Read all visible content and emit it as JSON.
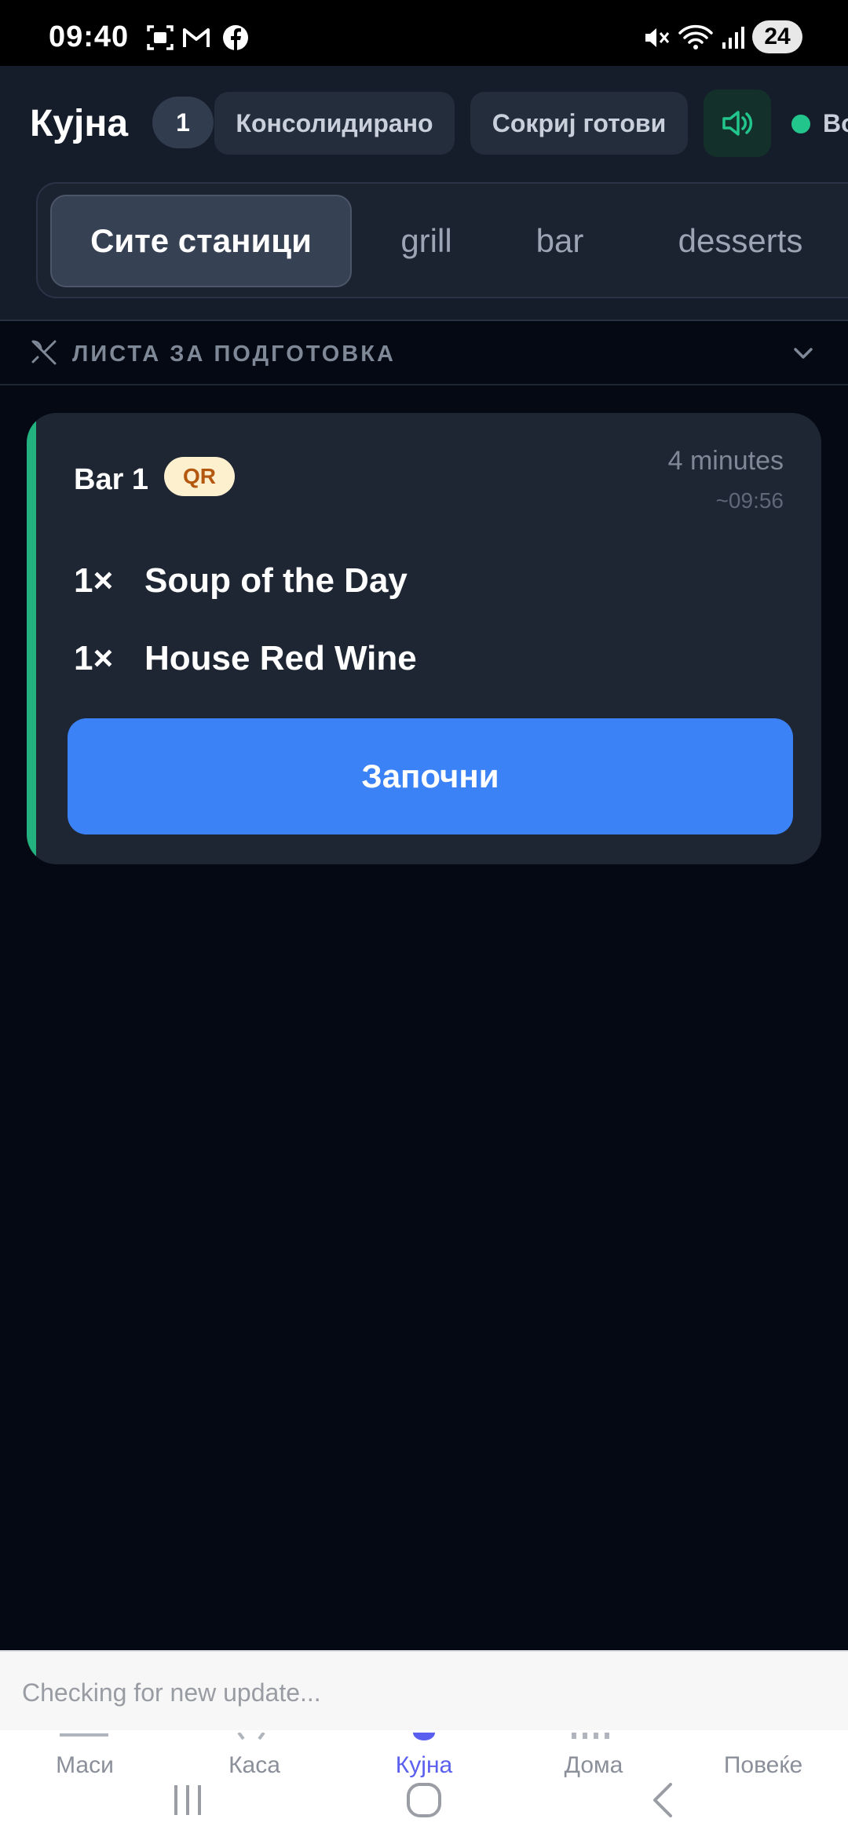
{
  "status_bar": {
    "time": "09:40",
    "battery": "24",
    "icons": [
      "screenshot-icon",
      "gmail-icon",
      "facebook-icon",
      "mute-icon",
      "wifi-icon",
      "signal-icon"
    ]
  },
  "header": {
    "title": "Кујна",
    "order_count": "1",
    "consolidated_label": "Консолидирано",
    "hide_done_label": "Сокриј готови",
    "sound_icon": "speaker-icon",
    "connection_label": "Во",
    "connection_color": "#22c58b"
  },
  "stations": {
    "tabs": [
      {
        "label": "Сите станици",
        "active": true
      },
      {
        "label": "grill",
        "active": false
      },
      {
        "label": "bar",
        "active": false
      },
      {
        "label": "desserts",
        "active": false
      }
    ]
  },
  "prep_list": {
    "label": "ЛИСТА ЗА ПОДГОТОВКА",
    "icon": "utensils-icon",
    "expanded": false
  },
  "orders": [
    {
      "table": "Bar 1",
      "source_badge": "QR",
      "elapsed": "4 minutes",
      "eta": "~09:56",
      "accent_color": "#22b17f",
      "items": [
        {
          "qty": "1×",
          "name": "Soup of the Day"
        },
        {
          "qty": "1×",
          "name": "House Red Wine"
        }
      ],
      "action_label": "Започни",
      "action_color": "#3b82f6"
    }
  ],
  "update_banner": {
    "text": "Checking for new update..."
  },
  "bottom_nav": {
    "items": [
      {
        "label": "Маси",
        "active": false
      },
      {
        "label": "Каса",
        "active": false
      },
      {
        "label": "Кујна",
        "active": true
      },
      {
        "label": "Дома",
        "active": false
      },
      {
        "label": "Повеќе",
        "active": false
      }
    ],
    "active_color": "#5b5fef"
  }
}
